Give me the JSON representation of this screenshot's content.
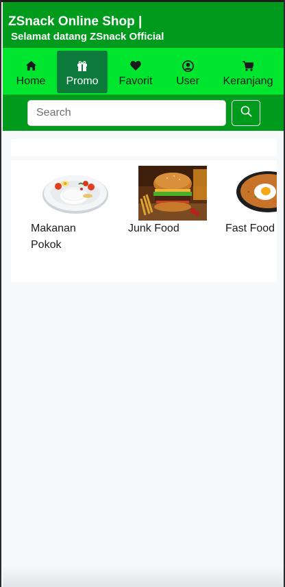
{
  "header": {
    "title": "ZSnack Online Shop |",
    "subtitle": "Selamat datang ZSnack Official"
  },
  "nav": {
    "items": [
      {
        "label": "Home",
        "icon": "home-icon",
        "active": false
      },
      {
        "label": "Promo",
        "icon": "gift-icon",
        "active": true
      },
      {
        "label": "Favorit",
        "icon": "heart-icon",
        "active": false
      },
      {
        "label": "User",
        "icon": "user-circle-icon",
        "active": false
      },
      {
        "label": "Keranjang",
        "icon": "cart-icon",
        "active": false
      }
    ]
  },
  "search": {
    "placeholder": "Search",
    "value": ""
  },
  "categories": [
    {
      "label": "Makanan Pokok",
      "image": "rice-plate"
    },
    {
      "label": "Junk Food",
      "image": "burger"
    },
    {
      "label": "Fast Food",
      "image": "fried-rice"
    }
  ],
  "colors": {
    "header_bg": "#009b1c",
    "nav_bg": "#00e62e",
    "nav_active_bg": "#0b7a3a",
    "page_bg": "#f6f8fa"
  }
}
